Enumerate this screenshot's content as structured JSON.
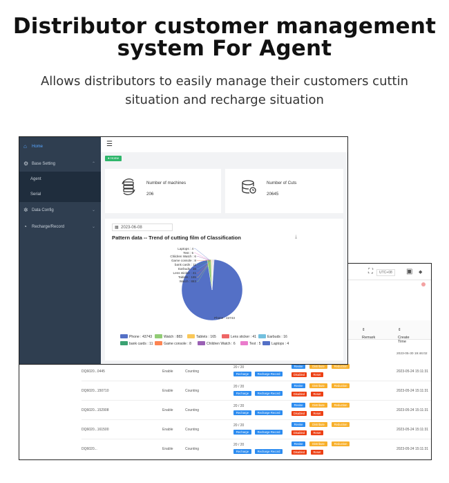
{
  "hero": {
    "title_line1": "Distributor customer management",
    "title_line2": "system For Agent",
    "subtitle_line1": "Allows distributors to easily manage their customers cuttin",
    "subtitle_line2": "situation and recharge situation"
  },
  "sidebar": {
    "items": [
      {
        "label": "Home",
        "icon": "home-icon"
      },
      {
        "label": "Base Setting",
        "icon": "gear-icon"
      },
      {
        "label": "Agent"
      },
      {
        "label": "Serial"
      },
      {
        "label": "Data Config",
        "icon": "gear-icon"
      },
      {
        "label": "Recharge/Record",
        "icon": "clock-icon"
      }
    ]
  },
  "breadcrumb": "● Home",
  "cards": [
    {
      "title": "Number of machines",
      "value": "206",
      "icon": "machines-icon"
    },
    {
      "title": "Number of Cuts",
      "value": "20645",
      "icon": "database-icon"
    }
  ],
  "chart_date": "2023-06-08",
  "chart_data": {
    "type": "pie",
    "title": "Pattern data -- Trend of cutting film of Classification",
    "slices": [
      {
        "name": "Phone",
        "value": 43743,
        "color": "#5470c6"
      },
      {
        "name": "Watch",
        "value": 883,
        "color": "#91cc75"
      },
      {
        "name": "Tablets",
        "value": 165,
        "color": "#fac858"
      },
      {
        "name": "Lens sticker",
        "value": 41,
        "color": "#ee6666"
      },
      {
        "name": "Earbuds",
        "value": 16,
        "color": "#73c0de"
      },
      {
        "name": "bank cards",
        "value": 11,
        "color": "#3ba272"
      },
      {
        "name": "Game console",
        "value": 8,
        "color": "#fc8452"
      },
      {
        "name": "Children Watch",
        "value": 6,
        "color": "#9a60b4"
      },
      {
        "name": "Test",
        "value": 5,
        "color": "#ea7ccc"
      },
      {
        "name": "Laptops",
        "value": 4,
        "color": "#5470c6"
      }
    ],
    "label_format": "{name} : {value}"
  },
  "back_window": {
    "utc": "UTC+08",
    "columns": [
      "Remark",
      "Create Time"
    ],
    "first_time": "2023-05-30 19:46:02",
    "rows": [
      {
        "id": "DQ6020...0445",
        "status": "Enable",
        "state": "Counting",
        "count": "20 / 20",
        "time": "2023-05-24 15:11:31"
      },
      {
        "id": "DQ6020...150710",
        "status": "Enable",
        "state": "Counting",
        "count": "20 / 20",
        "time": "2023-05-24 15:11:31"
      },
      {
        "id": "DQ6020...152908",
        "status": "Enable",
        "state": "Counting",
        "count": "20 / 20",
        "time": "2023-05-24 15:11:31"
      },
      {
        "id": "DQ6020...161500",
        "status": "Enable",
        "state": "Counting",
        "count": "20 / 20",
        "time": "2023-05-24 15:11:31"
      },
      {
        "id": "DQ6020...",
        "status": "Enable",
        "state": "Counting",
        "count": "20 / 20",
        "time": "2023-05-24 15:11:31"
      }
    ],
    "buttons": {
      "recharge": "Recharge",
      "record": "Recharge Record",
      "revise": "Revise",
      "distribute": "Distribute",
      "reduction": "Reduction",
      "disabled": "Disabled",
      "reset": "Reset"
    }
  }
}
